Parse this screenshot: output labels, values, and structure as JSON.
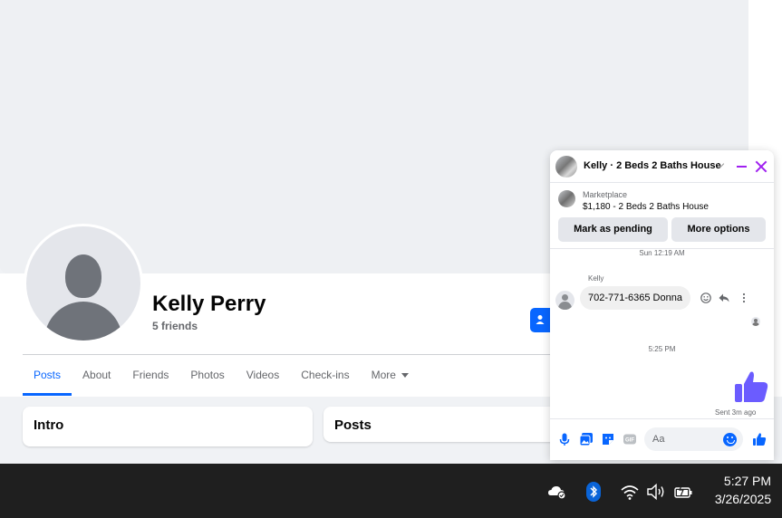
{
  "profile": {
    "name": "Kelly Perry",
    "friends": "5 friends"
  },
  "tabs": [
    {
      "label": "Posts"
    },
    {
      "label": "About"
    },
    {
      "label": "Friends"
    },
    {
      "label": "Photos"
    },
    {
      "label": "Videos"
    },
    {
      "label": "Check-ins"
    },
    {
      "label": "More"
    }
  ],
  "cards": {
    "intro_title": "Intro",
    "posts_title": "Posts"
  },
  "chat": {
    "title": "Kelly · 2 Beds 2 Baths House",
    "marketplace_label": "Marketplace",
    "listing": "$1,180 - 2 Beds 2 Baths House",
    "pending_button": "Mark as pending",
    "more_button": "More options",
    "timestamp_1": "Sun 12:19 AM",
    "sender": "Kelly",
    "message": "702-771-6365 Donna",
    "timestamp_2": "5:25 PM",
    "sent_status": "Sent 3m ago",
    "input_placeholder": "Aa",
    "accent_color": "#a020f0",
    "like_color": "#6b5cff"
  },
  "taskbar": {
    "time": "5:27 PM",
    "date": "3/26/2025"
  }
}
